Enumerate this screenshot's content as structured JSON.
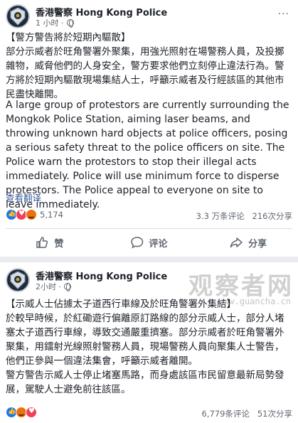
{
  "posts": [
    {
      "page_name": "香港警察 Hong Kong Police",
      "time": "1 小时 ·",
      "more_label": "···",
      "zh_paragraphs": [
        "【警方警告將於短期內驅散】",
        "部分示威者於旺角警署外聚集，用強光照射在場警務人員，及投擲雜物，威脅他們的人身安全，警方要求他們立刻停止違法行為。警方將於短期內驅散現場集結人士，呼籲示威者及行經該區的其他市民盡快離開。"
      ],
      "en_text": "A large group of protestors are currently surrounding the Mongkok Police Station, aiming laser beams, and throwing unknown hard objects at police officers, posing a serious safety threat to the police officers on site. The Police warn the protestors to stop their illegal acts immediately. Police will use minimum force to disperse protestors. The Police appeal to everyone on site to leave immediately.",
      "see_translation": "查看翻译",
      "reaction_count": "5,174",
      "comments": "3.3 万条评论",
      "shares": "216次分享",
      "actions": {
        "like": "赞",
        "comment": "评论",
        "share": "分享"
      }
    },
    {
      "page_name": "香港警察 Hong Kong Police",
      "time": "2小时 ·",
      "more_label": "···",
      "zh_paragraphs": [
        "【示威人士佔據太子道西行車線及於旺角警署外集結】",
        "於較早時候，於紅磡遊行偏離原訂路線的部分示威人士，部分人堵塞太子道西行車線，導致交通嚴重擠塞。部分示威者於旺角警署外聚集，用鐳射光線照射警務人員，現場警務人員向聚集人士警告，他們正參與一個違法集會，呼籲示威者離開。",
        "警方警告示威人士停止堵塞馬路，而身處該區市民留意最新局勢發展，駕駛人士避免前往該區。"
      ],
      "reaction_count": "",
      "comments": "6,779条评论",
      "shares": "51次分享"
    }
  ],
  "watermark": {
    "big": "观察者网",
    "small": "www.guancha.cn"
  },
  "colors": {
    "link": "#385898",
    "like": "#1877f2",
    "love": "#f33e58",
    "angry": "#e9710f"
  },
  "icons": [
    "police-badge-icon",
    "globe-icon",
    "more-icon",
    "like-reaction-icon",
    "love-reaction-icon",
    "angry-reaction-icon",
    "thumbs-up-icon",
    "comment-icon",
    "share-icon"
  ]
}
